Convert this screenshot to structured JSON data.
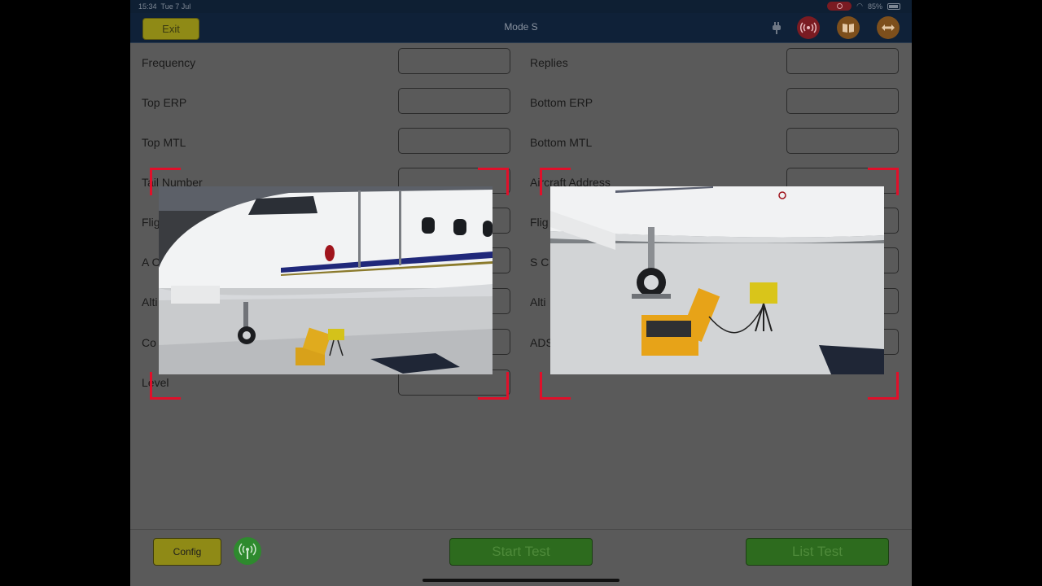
{
  "status_bar": {
    "time": "15:34",
    "date": "Tue 7 Jul",
    "battery": "85%"
  },
  "header": {
    "exit_label": "Exit",
    "title": "Mode S",
    "icons": [
      "plug-icon",
      "broadcast-icon",
      "manual-icon",
      "arrows-icon"
    ]
  },
  "form": {
    "left": [
      {
        "label": "Frequency",
        "value": ""
      },
      {
        "label": "Top ERP",
        "value": ""
      },
      {
        "label": "Top MTL",
        "value": ""
      },
      {
        "label": "Tail Number",
        "value": ""
      },
      {
        "label": "Flig",
        "value": ""
      },
      {
        "label": "A C",
        "value": ""
      },
      {
        "label": "Alti",
        "value": ""
      },
      {
        "label": "Co",
        "value": ""
      },
      {
        "label": "Level",
        "value": ""
      }
    ],
    "right": [
      {
        "label": "Replies",
        "value": ""
      },
      {
        "label": "Bottom ERP",
        "value": ""
      },
      {
        "label": "Bottom MTL",
        "value": ""
      },
      {
        "label": "Aircraft Address",
        "value": ""
      },
      {
        "label": "Flig",
        "value": ""
      },
      {
        "label": "S C",
        "value": ""
      },
      {
        "label": "Alti",
        "value": ""
      },
      {
        "label": "ADS",
        "value": ""
      }
    ]
  },
  "photos": [
    "aircraft-nose-photo",
    "aircraft-gear-photo"
  ],
  "footer": {
    "config_label": "Config",
    "start_label": "Start Test",
    "list_label": "List Test"
  },
  "colors": {
    "accent_yellow": "#8f8a16",
    "green": "#2d6b1e",
    "header": "#0f2138",
    "marker_red": "#e0102a"
  }
}
